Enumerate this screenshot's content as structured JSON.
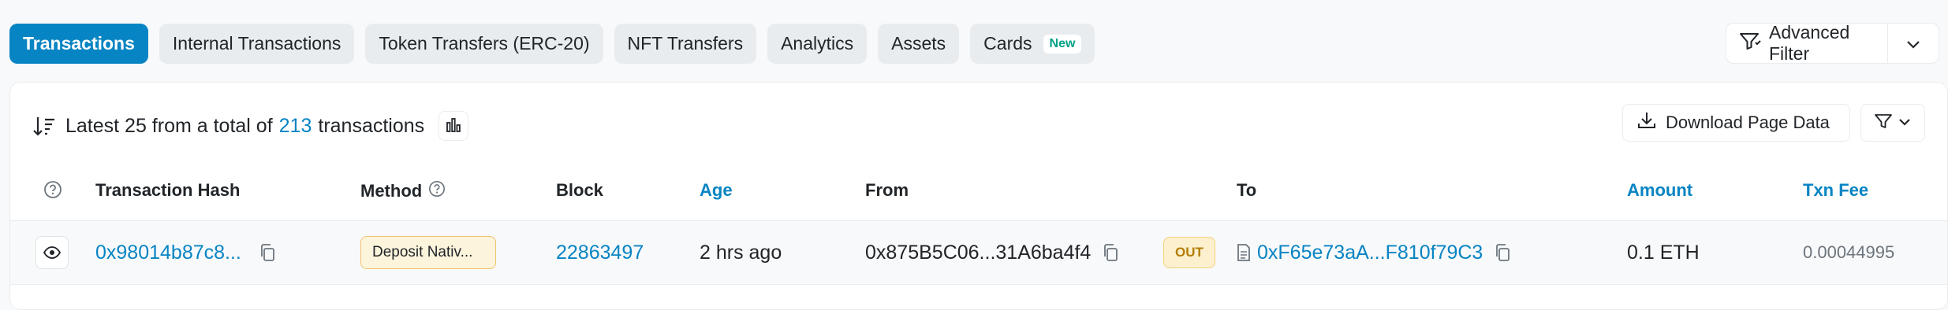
{
  "tabs": [
    {
      "label": "Transactions",
      "active": true
    },
    {
      "label": "Internal Transactions"
    },
    {
      "label": "Token Transfers (ERC-20)"
    },
    {
      "label": "NFT Transfers"
    },
    {
      "label": "Analytics"
    },
    {
      "label": "Assets"
    },
    {
      "label": "Cards",
      "badge": "New"
    }
  ],
  "advanced_filter": {
    "label": "Advanced Filter"
  },
  "summary": {
    "prefix": "Latest 25 from a total of",
    "count": "213",
    "suffix": "transactions"
  },
  "download": {
    "label": "Download Page Data"
  },
  "table": {
    "headers": {
      "hash": "Transaction Hash",
      "method": "Method",
      "block": "Block",
      "age": "Age",
      "from": "From",
      "to": "To",
      "amount": "Amount",
      "fee": "Txn Fee"
    },
    "rows": [
      {
        "hash": "0x98014b87c8...",
        "method": "Deposit Nativ...",
        "block": "22863497",
        "age": "2 hrs ago",
        "from": "0x875B5C06...31A6ba4f4",
        "direction": "OUT",
        "to": "0xF65e73aA...F810f79C3",
        "amount": "0.1 ETH",
        "fee": "0.00044995"
      }
    ]
  },
  "colors": {
    "accent": "#0784c3",
    "tab_bg": "#e9ecef",
    "badge_green": "#00a186",
    "out_badge": "#b47d00"
  },
  "icons": [
    "sort-icon",
    "bar-chart-icon",
    "download-icon",
    "filter-icon",
    "chevron-down-icon",
    "question-icon",
    "eye-icon",
    "copy-icon",
    "contract-icon"
  ]
}
